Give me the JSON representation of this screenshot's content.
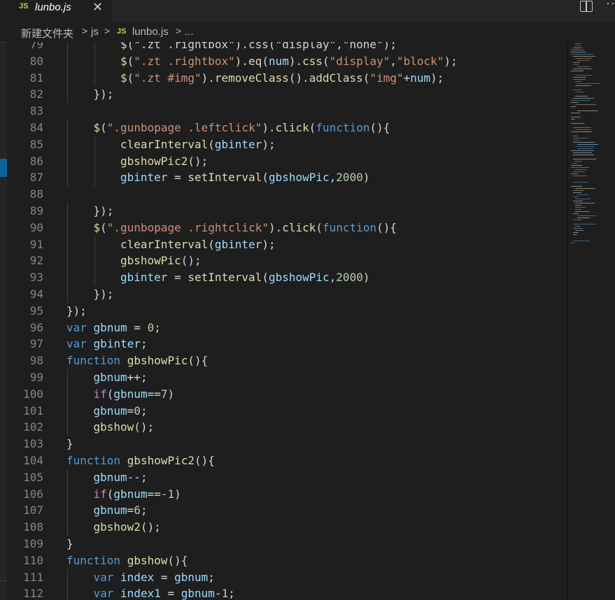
{
  "tab": {
    "icon": "JS",
    "title": "lunbo.js",
    "close": "✕"
  },
  "titlebar": {
    "split_icon": "split-editor-icon",
    "more": "···"
  },
  "breadcrumb": {
    "items": [
      "新建文件夹",
      "js",
      "lunbo.js",
      "..."
    ],
    "separator": ">",
    "file_icon": "JS"
  },
  "lines": [
    {
      "n": "79",
      "indent": 2,
      "tokens": [
        [
          "pl",
          "$(\".zt .rightbox\").css(\"display\",\"none\");"
        ]
      ]
    },
    {
      "n": "80",
      "indent": 2,
      "tokens": [
        [
          "fn",
          "$"
        ],
        [
          "pl",
          "("
        ],
        [
          "str",
          "\".zt .rightbox\""
        ],
        [
          "pl",
          ")."
        ],
        [
          "fn",
          "eq"
        ],
        [
          "pl",
          "("
        ],
        [
          "vr",
          "num"
        ],
        [
          "pl",
          ")."
        ],
        [
          "fn",
          "css"
        ],
        [
          "pl",
          "("
        ],
        [
          "str",
          "\"display\""
        ],
        [
          "pl",
          ","
        ],
        [
          "str",
          "\"block\""
        ],
        [
          "pl",
          ");"
        ]
      ]
    },
    {
      "n": "81",
      "indent": 2,
      "tokens": [
        [
          "fn",
          "$"
        ],
        [
          "pl",
          "("
        ],
        [
          "str",
          "\".zt #img\""
        ],
        [
          "pl",
          ")."
        ],
        [
          "fn",
          "removeClass"
        ],
        [
          "pl",
          "()."
        ],
        [
          "fn",
          "addClass"
        ],
        [
          "pl",
          "("
        ],
        [
          "str",
          "\"img\""
        ],
        [
          "pl",
          "+"
        ],
        [
          "vr",
          "num"
        ],
        [
          "pl",
          ");"
        ]
      ]
    },
    {
      "n": "82",
      "indent": 1,
      "tokens": [
        [
          "pl",
          "});"
        ]
      ]
    },
    {
      "n": "83",
      "indent": 0,
      "tokens": []
    },
    {
      "n": "84",
      "indent": 1,
      "tokens": [
        [
          "fn",
          "$"
        ],
        [
          "pl",
          "("
        ],
        [
          "str",
          "\".gunbopage .leftclick\""
        ],
        [
          "pl",
          ")."
        ],
        [
          "fn",
          "click"
        ],
        [
          "pl",
          "("
        ],
        [
          "kw",
          "function"
        ],
        [
          "pl",
          "(){"
        ]
      ]
    },
    {
      "n": "85",
      "indent": 2,
      "tokens": [
        [
          "fn",
          "clearInterval"
        ],
        [
          "pl",
          "("
        ],
        [
          "vr",
          "gbinter"
        ],
        [
          "pl",
          ");"
        ]
      ]
    },
    {
      "n": "86",
      "indent": 2,
      "tokens": [
        [
          "fn",
          "gbshowPic2"
        ],
        [
          "pl",
          "();"
        ]
      ]
    },
    {
      "n": "87",
      "indent": 2,
      "tokens": [
        [
          "vr",
          "gbinter"
        ],
        [
          "pl",
          " = "
        ],
        [
          "fn",
          "setInterval"
        ],
        [
          "pl",
          "("
        ],
        [
          "vr",
          "gbshowPic"
        ],
        [
          "pl",
          ","
        ],
        [
          "num",
          "2000"
        ],
        [
          "pl",
          ")"
        ]
      ]
    },
    {
      "n": "88",
      "indent": 0,
      "tokens": []
    },
    {
      "n": "89",
      "indent": 1,
      "tokens": [
        [
          "pl",
          "});"
        ]
      ]
    },
    {
      "n": "90",
      "indent": 1,
      "tokens": [
        [
          "fn",
          "$"
        ],
        [
          "pl",
          "("
        ],
        [
          "str",
          "\".gunbopage .rightclick\""
        ],
        [
          "pl",
          ")."
        ],
        [
          "fn",
          "click"
        ],
        [
          "pl",
          "("
        ],
        [
          "kw",
          "function"
        ],
        [
          "pl",
          "(){"
        ]
      ]
    },
    {
      "n": "91",
      "indent": 2,
      "tokens": [
        [
          "fn",
          "clearInterval"
        ],
        [
          "pl",
          "("
        ],
        [
          "vr",
          "gbinter"
        ],
        [
          "pl",
          ");"
        ]
      ]
    },
    {
      "n": "92",
      "indent": 2,
      "tokens": [
        [
          "fn",
          "gbshowPic"
        ],
        [
          "pl",
          "();"
        ]
      ]
    },
    {
      "n": "93",
      "indent": 2,
      "tokens": [
        [
          "vr",
          "gbinter"
        ],
        [
          "pl",
          " = "
        ],
        [
          "fn",
          "setInterval"
        ],
        [
          "pl",
          "("
        ],
        [
          "vr",
          "gbshowPic"
        ],
        [
          "pl",
          ","
        ],
        [
          "num",
          "2000"
        ],
        [
          "pl",
          ")"
        ]
      ]
    },
    {
      "n": "94",
      "indent": 1,
      "tokens": [
        [
          "pl",
          "});"
        ]
      ]
    },
    {
      "n": "95",
      "indent": 0,
      "tokens": [
        [
          "pl",
          "});"
        ]
      ]
    },
    {
      "n": "96",
      "indent": 0,
      "tokens": [
        [
          "kw",
          "var"
        ],
        [
          "pl",
          " "
        ],
        [
          "vr",
          "gbnum"
        ],
        [
          "pl",
          " = "
        ],
        [
          "num",
          "0"
        ],
        [
          "pl",
          ";"
        ]
      ]
    },
    {
      "n": "97",
      "indent": 0,
      "tokens": [
        [
          "kw",
          "var"
        ],
        [
          "pl",
          " "
        ],
        [
          "vr",
          "gbinter"
        ],
        [
          "pl",
          ";"
        ]
      ]
    },
    {
      "n": "98",
      "indent": 0,
      "tokens": [
        [
          "kw",
          "function"
        ],
        [
          "pl",
          " "
        ],
        [
          "fn",
          "gbshowPic"
        ],
        [
          "pl",
          "(){"
        ]
      ]
    },
    {
      "n": "99",
      "indent": 1,
      "tokens": [
        [
          "vr",
          "gbnum"
        ],
        [
          "pl",
          "++;"
        ]
      ]
    },
    {
      "n": "100",
      "indent": 1,
      "tokens": [
        [
          "ctl",
          "if"
        ],
        [
          "pl",
          "("
        ],
        [
          "vr",
          "gbnum"
        ],
        [
          "pl",
          "=="
        ],
        [
          "num",
          "7"
        ],
        [
          "pl",
          ")"
        ]
      ]
    },
    {
      "n": "101",
      "indent": 1,
      "tokens": [
        [
          "vr",
          "gbnum"
        ],
        [
          "pl",
          "="
        ],
        [
          "num",
          "0"
        ],
        [
          "pl",
          ";"
        ]
      ]
    },
    {
      "n": "102",
      "indent": 1,
      "tokens": [
        [
          "fn",
          "gbshow"
        ],
        [
          "pl",
          "();"
        ]
      ]
    },
    {
      "n": "103",
      "indent": 0,
      "tokens": [
        [
          "pl",
          "}"
        ]
      ]
    },
    {
      "n": "104",
      "indent": 0,
      "tokens": [
        [
          "kw",
          "function"
        ],
        [
          "pl",
          " "
        ],
        [
          "fn",
          "gbshowPic2"
        ],
        [
          "pl",
          "(){"
        ]
      ]
    },
    {
      "n": "105",
      "indent": 1,
      "tokens": [
        [
          "vr",
          "gbnum"
        ],
        [
          "pl",
          "--;"
        ]
      ]
    },
    {
      "n": "106",
      "indent": 1,
      "tokens": [
        [
          "ctl",
          "if"
        ],
        [
          "pl",
          "("
        ],
        [
          "vr",
          "gbnum"
        ],
        [
          "pl",
          "=="
        ],
        [
          "num",
          "-1"
        ],
        [
          "pl",
          ")"
        ]
      ]
    },
    {
      "n": "107",
      "indent": 1,
      "tokens": [
        [
          "vr",
          "gbnum"
        ],
        [
          "pl",
          "="
        ],
        [
          "num",
          "6"
        ],
        [
          "pl",
          ";"
        ]
      ]
    },
    {
      "n": "108",
      "indent": 1,
      "tokens": [
        [
          "fn",
          "gbshow2"
        ],
        [
          "pl",
          "();"
        ]
      ]
    },
    {
      "n": "109",
      "indent": 0,
      "tokens": [
        [
          "pl",
          "}"
        ]
      ]
    },
    {
      "n": "110",
      "indent": 0,
      "tokens": [
        [
          "kw",
          "function"
        ],
        [
          "pl",
          " "
        ],
        [
          "fn",
          "gbshow"
        ],
        [
          "pl",
          "(){"
        ]
      ]
    },
    {
      "n": "111",
      "indent": 1,
      "tokens": [
        [
          "kw",
          "var"
        ],
        [
          "pl",
          " "
        ],
        [
          "vr",
          "index"
        ],
        [
          "pl",
          " = "
        ],
        [
          "vr",
          "gbnum"
        ],
        [
          "pl",
          ";"
        ]
      ]
    },
    {
      "n": "112",
      "indent": 1,
      "tokens": [
        [
          "kw",
          "var"
        ],
        [
          "pl",
          " "
        ],
        [
          "vr",
          "index1"
        ],
        [
          "pl",
          " = "
        ],
        [
          "vr",
          "gbnum"
        ],
        [
          "pl",
          "-"
        ],
        [
          "num",
          "1"
        ],
        [
          "pl",
          ";"
        ]
      ]
    }
  ],
  "colors": {
    "background": "#1e1e1e",
    "keyword": "#569cd6",
    "control": "#c586c0",
    "function": "#dcdcaa",
    "string": "#ce9178",
    "variable": "#9cdcfe",
    "number": "#b5cea8",
    "plain": "#d4d4d4",
    "line_number": "#858585",
    "js_icon": "#cbcb41"
  }
}
